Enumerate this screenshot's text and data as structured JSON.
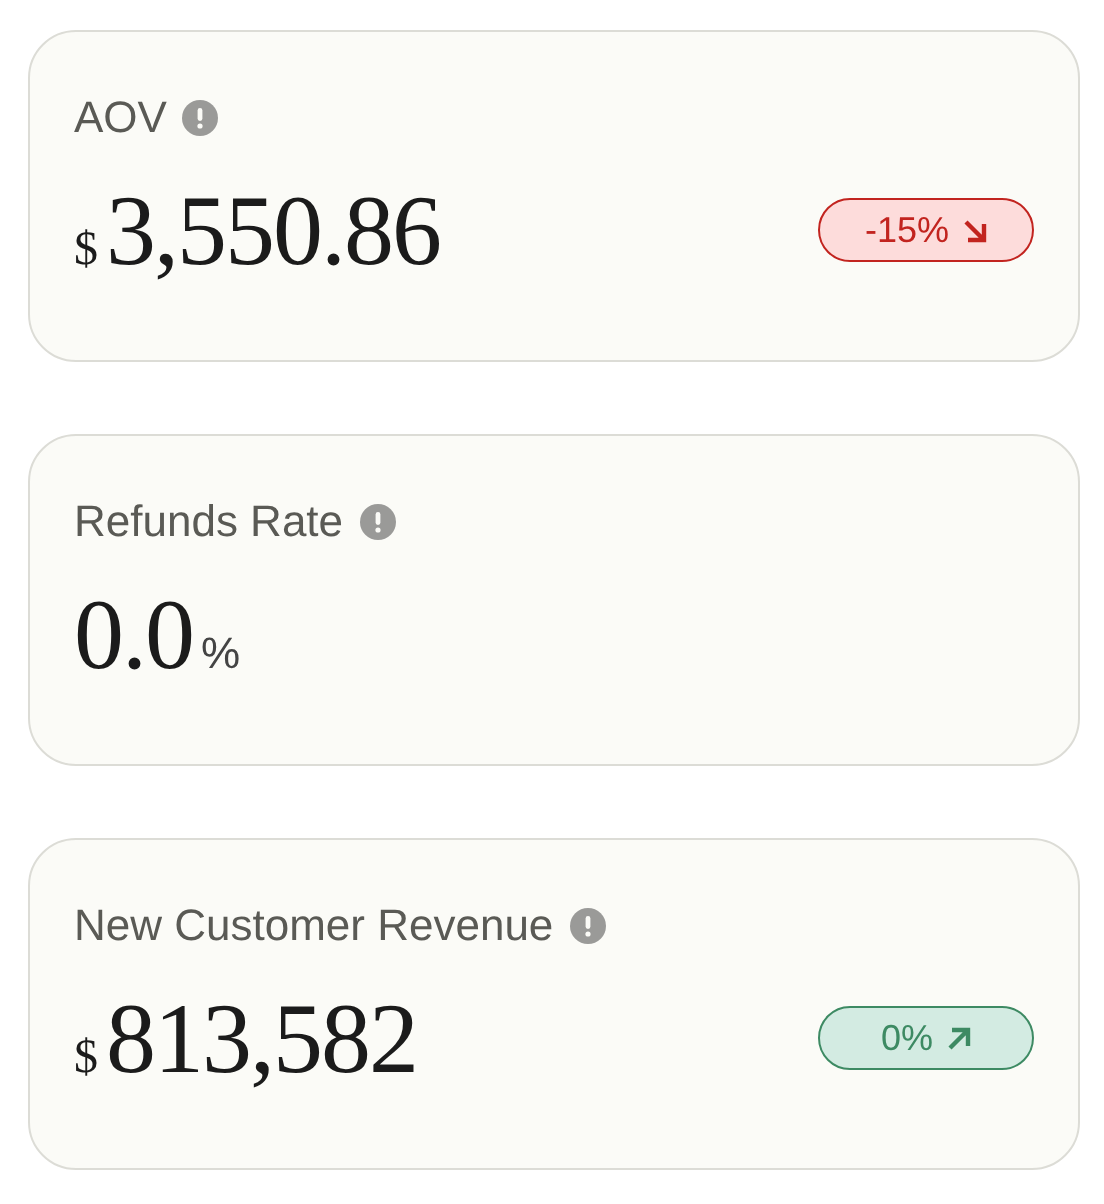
{
  "cards": [
    {
      "title": "AOV",
      "prefix": "$",
      "value": "3,550.86",
      "badge": {
        "text": "-15%",
        "kind": "down"
      }
    },
    {
      "title": "Refunds Rate",
      "value": "0.0",
      "suffix": "%"
    },
    {
      "title": "New Customer Revenue",
      "prefix": "$",
      "value": "813,582",
      "badge": {
        "text": "0%",
        "kind": "up"
      }
    }
  ]
}
